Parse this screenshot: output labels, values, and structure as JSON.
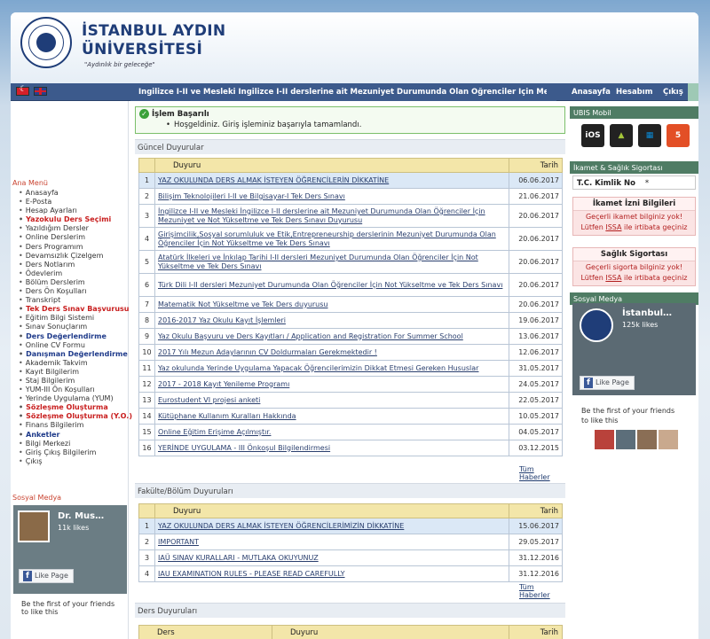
{
  "header": {
    "brand_line1": "İSTANBUL AYDIN",
    "brand_line2": "ÜNİVERSİTESİ",
    "slogan": "\"Aydınlık bir geleceğe\""
  },
  "navbar": {
    "ticker": "İngilizce I-II ve Mesleki İngilizce I-II derslerine ait Mezuniyet Durumunda Olan Öğrenciler İçin Mezuniyet ve",
    "links": [
      "Anasayfa",
      "Hesabım",
      "Çıkış"
    ]
  },
  "sidebar": {
    "menu_title": "Ana Menü",
    "items": [
      {
        "label": "Anasayfa",
        "style": "normal"
      },
      {
        "label": "E-Posta",
        "style": "normal"
      },
      {
        "label": "Hesap Ayarları",
        "style": "normal"
      },
      {
        "label": "Yazokulu Ders Seçimi",
        "style": "red"
      },
      {
        "label": "Yazıldığım Dersler",
        "style": "normal"
      },
      {
        "label": "Online Derslerim",
        "style": "normal"
      },
      {
        "label": "Ders Programım",
        "style": "normal"
      },
      {
        "label": "Devamsızlık Çizelgem",
        "style": "normal"
      },
      {
        "label": "Ders Notlarım",
        "style": "normal"
      },
      {
        "label": "Ödevlerim",
        "style": "normal"
      },
      {
        "label": "Bölüm Derslerim",
        "style": "normal"
      },
      {
        "label": "Ders Ön Koşulları",
        "style": "normal"
      },
      {
        "label": "Transkript",
        "style": "normal"
      },
      {
        "label": "Tek Ders Sınav Başvurusu",
        "style": "red"
      },
      {
        "label": "Eğitim Bilgi Sistemi",
        "style": "normal"
      },
      {
        "label": "Sınav Sonuçlarım",
        "style": "normal"
      },
      {
        "label": "Ders Değerlendirme",
        "style": "navy"
      },
      {
        "label": "Online CV Formu",
        "style": "normal"
      },
      {
        "label": "Danışman Değerlendirme",
        "style": "navy"
      },
      {
        "label": "Akademik Takvim",
        "style": "normal"
      },
      {
        "label": "Kayıt Bilgilerim",
        "style": "normal"
      },
      {
        "label": "Staj Bilgilerim",
        "style": "normal"
      },
      {
        "label": "YUM-III Ön Koşulları",
        "style": "normal"
      },
      {
        "label": "Yerinde Uygulama (YUM)",
        "style": "normal"
      },
      {
        "label": "Sözleşme Oluşturma",
        "style": "red"
      },
      {
        "label": "Sözleşme Oluşturma (Y.O.)",
        "style": "red"
      },
      {
        "label": "Finans Bilgilerim",
        "style": "normal"
      },
      {
        "label": "Anketler",
        "style": "navy"
      },
      {
        "label": "Bilgi Merkezi",
        "style": "normal"
      },
      {
        "label": "Giriş Çıkış Bilgilerim",
        "style": "normal"
      },
      {
        "label": "Çıkış",
        "style": "normal"
      }
    ],
    "social_title": "Sosyal Medya",
    "fb": {
      "name": "Dr. Mus…",
      "likes": "11k likes",
      "button": "Like Page",
      "footer": "Be the first of your friends to like this"
    }
  },
  "alert": {
    "title": "İşlem Başarılı",
    "message": "Hoşgeldiniz. Giriş işleminiz başarıyla tamamlandı."
  },
  "announcements": {
    "title": "Güncel Duyurular",
    "col_title": "Duyuru",
    "col_date": "Tarih",
    "more": "Tüm Haberler",
    "rows": [
      {
        "n": "1",
        "t": "YAZ OKULUNDA DERS ALMAK İSTEYEN ÖĞRENCİLERİN DİKKATİNE",
        "d": "06.06.2017"
      },
      {
        "n": "2",
        "t": "Bilişim Teknolojileri I-II ve Bilgisayar-I Tek Ders Sınavı",
        "d": "21.06.2017"
      },
      {
        "n": "3",
        "t": "İngilizce I-II ve Mesleki İngilizce I-II derslerine ait Mezuniyet Durumunda Olan Öğrenciler İçin Mezuniyet ve Not Yükseltme ve Tek Ders Sınavı Duyurusu",
        "d": "20.06.2017"
      },
      {
        "n": "4",
        "t": "Girişimcilik,Sosyal sorumluluk ve Etik,Entrepreneurship derslerinin Mezuniyet Durumunda Olan Öğrenciler İçin Not Yükseltme ve Tek Ders Sınavı",
        "d": "20.06.2017"
      },
      {
        "n": "5",
        "t": "Atatürk İlkeleri ve İnkılap Tarihi I-II dersleri Mezuniyet Durumunda Olan Öğrenciler İçin Not Yükseltme ve Tek Ders Sınavı",
        "d": "20.06.2017"
      },
      {
        "n": "6",
        "t": "Türk Dili I-II dersleri Mezuniyet Durumunda Olan Öğrenciler İçin Not Yükseltme ve Tek Ders Sınavı",
        "d": "20.06.2017"
      },
      {
        "n": "7",
        "t": "Matematik Not Yükseltme ve Tek Ders duyurusu",
        "d": "20.06.2017"
      },
      {
        "n": "8",
        "t": "2016-2017 Yaz Okulu Kayıt İşlemleri",
        "d": "19.06.2017"
      },
      {
        "n": "9",
        "t": "Yaz Okulu Başvuru ve Ders Kayıtları / Application and Registration For Summer School",
        "d": "13.06.2017"
      },
      {
        "n": "10",
        "t": "2017 Yılı Mezun Adaylarının CV Doldurmaları Gerekmektedir !",
        "d": "12.06.2017"
      },
      {
        "n": "11",
        "t": "Yaz okulunda Yerinde Uygulama Yapacak Öğrencilerimizin Dikkat Etmesi Gereken Hususlar",
        "d": "31.05.2017"
      },
      {
        "n": "12",
        "t": "2017 - 2018 Kayıt Yenileme Programı",
        "d": "24.05.2017"
      },
      {
        "n": "13",
        "t": "Eurostudent VI projesi anketi",
        "d": "22.05.2017"
      },
      {
        "n": "14",
        "t": "Kütüphane Kullanım Kuralları Hakkında",
        "d": "10.05.2017"
      },
      {
        "n": "15",
        "t": "Online Eğitim Erişime Açılmıştır.",
        "d": "04.05.2017"
      },
      {
        "n": "16",
        "t": "YERİNDE UYGULAMA - III Önkoşul Bilgilendirmesi",
        "d": "03.12.2015"
      }
    ]
  },
  "faculty": {
    "title": "Fakülte/Bölüm Duyuruları",
    "col_title": "Duyuru",
    "col_date": "Tarih",
    "more": "Tüm Haberler",
    "rows": [
      {
        "n": "1",
        "t": "YAZ OKULUNDA DERS ALMAK İSTEYEN ÖĞRENCİLERİMİZİN DİKKATİNE",
        "d": "15.06.2017"
      },
      {
        "n": "2",
        "t": "IMPORTANT",
        "d": "29.05.2017"
      },
      {
        "n": "3",
        "t": "IAÜ SINAV KURALLARI - MUTLAKA OKUYUNUZ",
        "d": "31.12.2016"
      },
      {
        "n": "4",
        "t": "IAU EXAMINATION RULES - PLEASE READ CAREFULLY",
        "d": "31.12.2016"
      }
    ]
  },
  "course": {
    "title": "Ders Duyuruları",
    "col_course": "Ders",
    "col_title": "Duyuru",
    "col_date": "Tarih"
  },
  "right": {
    "mobile_title": "UBIS Mobil",
    "apps": [
      "iOS",
      "android-icon",
      "windows-icon",
      "html5-icon"
    ],
    "insurance_title": "İkamet & Sağlık Sigortası",
    "tc_label": "T.C. Kimlik No",
    "tc_value": "*",
    "residence": {
      "title": "İkamet İzni Bilgileri",
      "line1": "Geçerli ikamet bilginiz yok!",
      "line2a": "Lütfen",
      "link": "ISSA",
      "line2b": "ile irtibata geçiniz"
    },
    "health": {
      "title": "Sağlık Sigortası",
      "line1": "Geçerli sigorta bilginiz yok!",
      "line2a": "Lütfen",
      "link": "ISSA",
      "line2b": "ile irtibata geçiniz"
    },
    "social_title": "Sosyal Medya",
    "fb": {
      "name": "İstanbul…",
      "likes": "125k likes",
      "button": "Like Page",
      "footer": "Be the first of your friends to like this"
    }
  },
  "colors": {
    "nav": "#3c5a8c",
    "accent_green": "#4f7c64",
    "table_header": "#f3e6a9",
    "alert_red": "#c81e1e"
  }
}
